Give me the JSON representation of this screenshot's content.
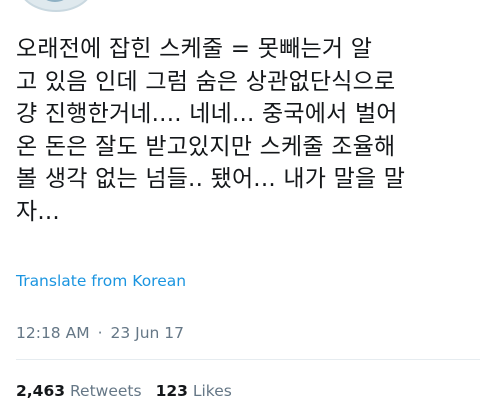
{
  "tweet": {
    "text_lines": [
      "오래전에 잡힌 스케줄 = 못빼는거 알",
      "고 있음 인데 그럼 숨은 상관없단식으로",
      "걍 진행한거네.... 네네... 중국에서 벌어",
      "온 돈은 잘도 받고있지만 스케줄 조율해",
      "볼 생각 없는 넘들.. 됐어... 내가 말을 말",
      "자..."
    ],
    "translate_label": "Translate from Korean",
    "time": "12:18 AM",
    "separator": "·",
    "date": "23 Jun 17"
  },
  "stats": {
    "retweets_count": "2,463",
    "retweets_label": "Retweets",
    "likes_count": "123",
    "likes_label": "Likes"
  },
  "colors": {
    "link": "#1b95e0",
    "secondary_text": "#657786",
    "primary_text": "#14171a",
    "divider": "#e6ecf0"
  }
}
